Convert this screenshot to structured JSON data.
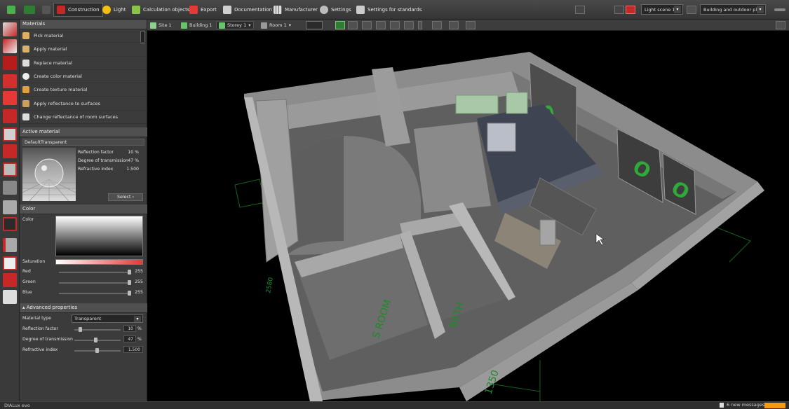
{
  "toolbar": {
    "tabs": [
      {
        "label": "Construction",
        "icon": "construction-icon",
        "active": true
      },
      {
        "label": "Light",
        "icon": "light-icon"
      },
      {
        "label": "Calculation objects",
        "icon": "calculation-objects-icon"
      },
      {
        "label": "Export",
        "icon": "export-icon"
      },
      {
        "label": "Documentation",
        "icon": "documentation-icon"
      },
      {
        "label": "Manufacturer",
        "icon": "manufacturer-icon"
      },
      {
        "label": "Settings",
        "icon": "gear-icon"
      },
      {
        "label": "Settings for standards",
        "icon": "standards-icon"
      }
    ],
    "light_scene": "Light scene 1",
    "planning_mode": "Building and outdoor pla..."
  },
  "breadcrumb": {
    "site": "Site 1",
    "building": "Building 1",
    "storey": "Storey 1",
    "room": "Room 1"
  },
  "materials": {
    "title": "Materials",
    "items": [
      "Pick material",
      "Apply material",
      "Replace material",
      "Create color material",
      "Create texture material",
      "Apply reflectance to surfaces",
      "Change reflectance of room surfaces"
    ]
  },
  "active_material": {
    "title": "Active material",
    "name": "DefaultTransparent",
    "reflection_factor_label": "Reflection factor",
    "reflection_factor_value": "10 %",
    "transmission_label": "Degree of transmission",
    "transmission_value": "47 %",
    "refractive_label": "Refractive index",
    "refractive_value": "1.500",
    "select_label": "Select"
  },
  "color": {
    "title": "Color",
    "color_label": "Color",
    "saturation_label": "Saturation",
    "red_label": "Red",
    "red_value": "255",
    "green_label": "Green",
    "green_value": "255",
    "blue_label": "Blue",
    "blue_value": "255"
  },
  "advanced": {
    "title": "Advanced properties",
    "material_type_label": "Material type",
    "material_type_value": "Transparent",
    "reflection_label": "Reflection factor",
    "reflection_value": "10",
    "transmission_label": "Degree of transmission",
    "transmission_value": "47",
    "refractive_label": "Refractive index",
    "refractive_value": "1.500",
    "unit": "%"
  },
  "viewport_labels": {
    "room_a": "S ROOM",
    "room_b": "BATH",
    "dimension": "1350",
    "dimension_left": "2580"
  },
  "statusbar": {
    "brand": "DIALux evo",
    "messages": "6 new messages"
  },
  "colors": {
    "accent_orange": "#f29a12",
    "highlight_green": "#4caf50",
    "active_red": "#c62828"
  }
}
